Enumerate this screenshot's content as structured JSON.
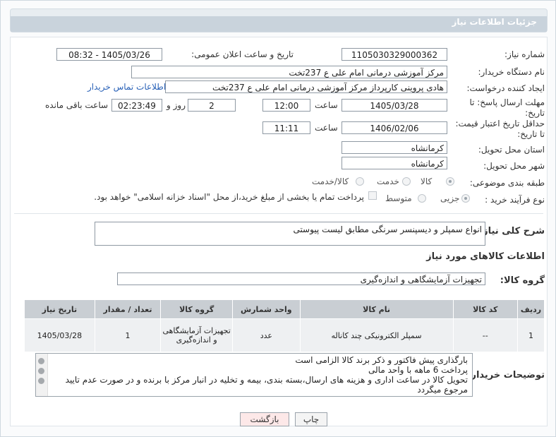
{
  "header": {
    "title": "جزئیات اطلاعات نیاز"
  },
  "form": {
    "need_number_label": "شماره نیاز:",
    "need_number": "1105030329000362",
    "announce_label": "تاریخ و ساعت اعلان عمومی:",
    "announce_value": "1405/03/26 - 08:32",
    "buyer_org_label": "نام دستگاه خریدار:",
    "buyer_org": "مرکز آموزشی درمانی امام علی ع 237تخت",
    "requester_label": "ایجاد کننده درخواست:",
    "requester": "هادی پروینی کارپرداز  مرکز آموزشی درمانی امام علی ع 237تخت",
    "contact_link": "اطلاعات تماس خریدار",
    "deadline_label": "مهلت ارسال پاسخ: تا تاریخ:",
    "deadline_date": "1405/03/28",
    "time_label": "ساعت",
    "deadline_time": "12:00",
    "days_value": "2",
    "days_label": "روز و",
    "remaining_value": "02:23:49",
    "remaining_label": "ساعت باقی مانده",
    "price_validity_label": "حداقل تاریخ اعتبار قیمت: تا تاریخ:",
    "price_date": "1406/02/06",
    "price_time": "11:11",
    "province_label": "استان محل تحویل:",
    "province": "کرمانشاه",
    "city_label": "شهر محل تحویل:",
    "city": "کرمانشاه",
    "category_label": "طبقه بندی موضوعی:",
    "category_options": [
      "کالا",
      "خدمت",
      "کالا/خدمت"
    ],
    "process_label": "نوع فرآیند خرید :",
    "process_options": [
      "جزیی",
      "متوسط"
    ],
    "payment_note": "پرداخت تمام یا بخشی از مبلغ خرید،از محل \"اسناد خزانه اسلامی\" خواهد بود."
  },
  "summary": {
    "label": "شرح کلی نیاز:",
    "value": "انواع سمپلر و دیسپنسر سرنگی مطابق لیست پیوستی"
  },
  "goods": {
    "section_title": "اطلاعات کالاهای مورد نیاز",
    "group_label": "گروه کالا:",
    "group_value": "تجهیزات آزمایشگاهی و اندازه‌گیری",
    "columns": [
      "ردیف",
      "کد کالا",
      "نام کالا",
      "واحد شمارش",
      "گروه کالا",
      "تعداد / مقدار",
      "تاریخ نیاز"
    ],
    "rows": [
      {
        "row": "1",
        "code": "--",
        "name": "سمپلر الکترونیکی چند کاناله",
        "unit": "عدد",
        "group": "تجهیزات آزمایشگاهی و اندازه‌گیری",
        "qty": "1",
        "date": "1405/03/28"
      }
    ]
  },
  "notes": {
    "label": "توضیحات خریدار:",
    "line1": "بارگذاری پیش فاکتور و ذکر برند کالا الزامی است",
    "line2": "پرداخت 6 ماهه با واحد مالی",
    "line3": "تحویل کالا در ساعت اداری و هزینه های ارسال،بسته بندی، بیمه و تخلیه در انبار مرکز با برنده و در صورت عدم تایید مرجوع میگردد"
  },
  "buttons": {
    "print": "چاپ",
    "back": "بازگشت"
  },
  "colors": {
    "link": "#2a62b8",
    "back_button_bg": "#fde8e8",
    "watermark": "#f3d6d6"
  }
}
